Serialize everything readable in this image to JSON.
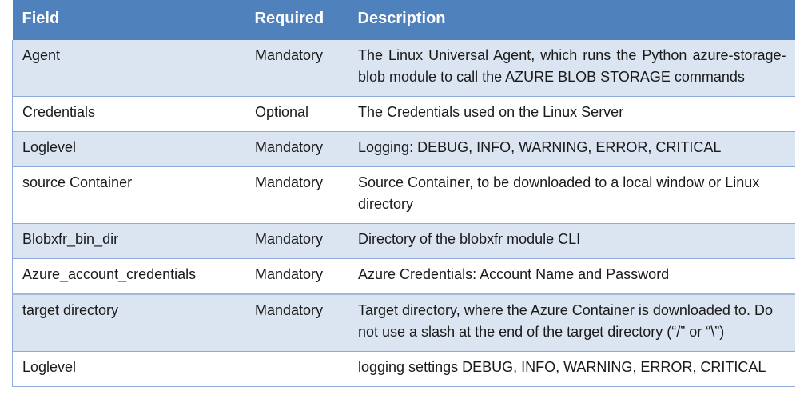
{
  "header": {
    "field": "Field",
    "required": "Required",
    "description": "Description"
  },
  "rows": [
    {
      "field": "Agent",
      "required": "Mandatory",
      "description": "The Linux Universal Agent, which runs the Python azure-storage-blob module to call the AZURE BLOB STORAGE commands"
    },
    {
      "field": "Credentials",
      "required": "Optional",
      "description": "The Credentials used on the Linux Server"
    },
    {
      "field": "Loglevel",
      "required": "Mandatory",
      "description": "Logging: DEBUG, INFO, WARNING, ERROR, CRITICAL"
    },
    {
      "field": "source Container",
      "required": "Mandatory",
      "description": "Source Container, to be downloaded to a local window or Linux directory"
    },
    {
      "field": "Blobxfr_bin_dir",
      "required": "Mandatory",
      "description": "Directory of the blobxfr module CLI"
    },
    {
      "field": "Azure_account_credentials",
      "required": "Mandatory",
      "description": "Azure Credentials: Account Name and Password"
    },
    {
      "field": "target directory",
      "required": "Mandatory",
      "description": "Target directory, where the Azure Container is downloaded to. Do not use a slash at the end of the target directory (“/” or “\\”)"
    },
    {
      "field": "Loglevel",
      "required": "",
      "description": "logging settings DEBUG, INFO, WARNING, ERROR, CRITICAL"
    }
  ],
  "colors": {
    "header_bg": "#4f81bd",
    "band_bg": "#dbe5f1",
    "border": "#8eaadb"
  }
}
